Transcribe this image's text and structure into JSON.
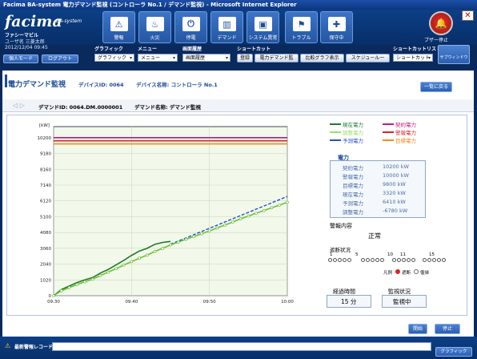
{
  "window": {
    "title": "Facima BA-system 電力デマンド監視 (コントローラ No.1 / デマンド監視) - Microsoft Internet Explorer"
  },
  "logo": {
    "text": "facima",
    "sub": "BA-system"
  },
  "toolbar": [
    {
      "label": "警報",
      "icon": "warning-icon"
    },
    {
      "label": "火災",
      "icon": "fire-icon"
    },
    {
      "label": "停電",
      "icon": "power-icon"
    },
    {
      "label": "デマンド",
      "icon": "demand-icon"
    },
    {
      "label": "システム異常",
      "icon": "system-icon"
    },
    {
      "label": "トラブル",
      "icon": "trouble-icon"
    },
    {
      "label": "保守中",
      "icon": "maintenance-icon"
    }
  ],
  "buzzer": {
    "label": "ブザー停止"
  },
  "user": {
    "name": "ファシーマビル",
    "user": "ユーザ名 三菱太郎",
    "datetime": "2012/12/04 09:45"
  },
  "nav": {
    "login": "個人モード",
    "logout": "ログアウト",
    "graphic_label": "グラフィック",
    "graphic_value": "グラフィック",
    "menu_label": "メニュー",
    "menu_value": "メニュー",
    "history_label": "画面履歴",
    "history_value": "画面履歴",
    "shortcut_label": "ショートカット",
    "register": "登録",
    "sc1": "電力デマンド監",
    "sc2": "比較グラフ表示",
    "sc3": "スケジュール一",
    "shortcutlist_label": "ショートカットリスト",
    "shortcutlist_value": "ショートカット",
    "subwindow": "サブウィンドウ"
  },
  "page": {
    "title": "電力デマンド監視",
    "device_id": "デバイスID:  0064",
    "device_name": "デバイス名称:  コントローラ No.1",
    "demand_id": "デマンドID:  0064.DM.0000001",
    "demand_name": "デマンド名称:  デマンド監視",
    "back": "一覧に戻る"
  },
  "chart_data": {
    "type": "line",
    "ylabel": "[kW]",
    "ylim": [
      0,
      10710
    ],
    "yticks": [
      0,
      1020,
      2040,
      3060,
      4080,
      5100,
      6120,
      7140,
      8160,
      9180,
      10200
    ],
    "xlabels": [
      "09:30",
      "09:40",
      "09:50",
      "10:00"
    ],
    "x_minutes": [
      0,
      10,
      20,
      30
    ],
    "series": [
      {
        "name": "契約電力",
        "color": "#c0187f",
        "values": [
          10200,
          10200
        ]
      },
      {
        "name": "警報電力",
        "color": "#d4242a",
        "values": [
          10000,
          10000
        ]
      },
      {
        "name": "目標電力",
        "color": "#f08a1d",
        "values": [
          9800,
          9800
        ]
      },
      {
        "name": "現在電力",
        "color": "#1d7a2a",
        "x": [
          0,
          1,
          2,
          3,
          4,
          5,
          6,
          7,
          8,
          9,
          10,
          11,
          12,
          13,
          14,
          15
        ],
        "values": [
          0,
          400,
          620,
          850,
          1020,
          1170,
          1460,
          1690,
          1980,
          2280,
          2600,
          2880,
          3060,
          3320,
          3440,
          3500
        ]
      },
      {
        "name": "予測電力",
        "color": "#2451c8",
        "dash": true,
        "x": [
          15,
          30
        ],
        "values": [
          3320,
          6410
        ]
      },
      {
        "name": "調整電力",
        "color": "#6fbf3a",
        "x": [
          0,
          1,
          2,
          3,
          4,
          5,
          6,
          7,
          8,
          9,
          10,
          11,
          12,
          13,
          14,
          15,
          16,
          17,
          18,
          19,
          20,
          21,
          22,
          23,
          24,
          25,
          26,
          27,
          28,
          29,
          30
        ],
        "values": [
          0,
          320,
          520,
          720,
          900,
          1060,
          1300,
          1520,
          1740,
          1980,
          2200,
          2420,
          2620,
          2860,
          3060,
          3280,
          3460,
          3640,
          3820,
          4000,
          4180,
          4380,
          4560,
          4760,
          4960,
          5140,
          5320,
          5500,
          5680,
          5850,
          6030
        ]
      }
    ]
  },
  "legend": [
    {
      "name": "現在電力",
      "color": "#1d7a2a"
    },
    {
      "name": "契約電力",
      "color": "#c0187f"
    },
    {
      "name": "調整電力",
      "color": "#9be06a"
    },
    {
      "name": "警報電力",
      "color": "#d4242a"
    },
    {
      "name": "予測電力",
      "color": "#2451c8"
    },
    {
      "name": "目標電力",
      "color": "#f08a1d"
    }
  ],
  "power": {
    "title": "電力",
    "rows": [
      {
        "label": "契約電力",
        "value": "10200 kW"
      },
      {
        "label": "警報電力",
        "value": "10000 kW"
      },
      {
        "label": "目標電力",
        "value": "9800 kW"
      },
      {
        "label": "現在電力",
        "value": "3320 kW"
      },
      {
        "label": "予測電力",
        "value": "6410 kW"
      },
      {
        "label": "調整電力",
        "value": "-6780 kW"
      }
    ]
  },
  "alarm": {
    "title": "警報内容",
    "status": "正常"
  },
  "cutoff": {
    "title": "遮断状況",
    "numbers": [
      "1",
      "5",
      "10",
      "11",
      "15"
    ],
    "legend_label": "凡例",
    "legend_cut": "遮断",
    "legend_recover": "復帰"
  },
  "elapsed": {
    "title": "経過時間",
    "value": "15 分"
  },
  "monitor": {
    "title": "監視状況",
    "value": "監視中"
  },
  "actions": {
    "start": "開始",
    "stop": "停止"
  },
  "footer": {
    "label": "最新警報レコード",
    "graphic": "グラフィック"
  }
}
